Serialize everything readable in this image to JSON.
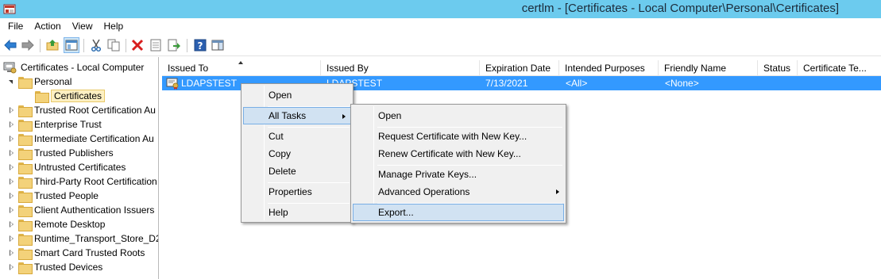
{
  "window": {
    "title": "certlm - [Certificates - Local Computer\\Personal\\Certificates]"
  },
  "menubar": [
    "File",
    "Action",
    "View",
    "Help"
  ],
  "toolbar": {
    "icons": [
      "back-arrow-icon",
      "forward-arrow-icon",
      "up-folder-icon",
      "show-hide-tree-icon",
      "cut-icon",
      "copy-icon",
      "delete-icon",
      "properties-icon",
      "export-list-icon",
      "help-icon",
      "action-pane-icon"
    ]
  },
  "tree": {
    "root": "Certificates - Local Computer",
    "personal": "Personal",
    "certificates": "Certificates",
    "items": [
      "Trusted Root Certification Au",
      "Enterprise Trust",
      "Intermediate Certification Au",
      "Trusted Publishers",
      "Untrusted Certificates",
      "Third-Party Root Certification",
      "Trusted People",
      "Client Authentication Issuers",
      "Remote Desktop",
      "Runtime_Transport_Store_D2",
      "Smart Card Trusted Roots",
      "Trusted Devices"
    ]
  },
  "list": {
    "columns": [
      "Issued To",
      "Issued By",
      "Expiration Date",
      "Intended Purposes",
      "Friendly Name",
      "Status",
      "Certificate Te..."
    ],
    "rows": [
      {
        "issued_to": "LDAPSTEST",
        "issued_by": "LDAPSTEST",
        "expiration": "7/13/2021",
        "purposes": "<All>",
        "friendly": "<None>",
        "status": "",
        "template": ""
      }
    ]
  },
  "context_menu": {
    "items": [
      "Open",
      "All Tasks",
      "Cut",
      "Copy",
      "Delete",
      "Properties",
      "Help"
    ]
  },
  "submenu": {
    "items": [
      "Open",
      "Request Certificate with New Key...",
      "Renew Certificate with New Key...",
      "Manage Private Keys...",
      "Advanced Operations",
      "Export..."
    ]
  }
}
